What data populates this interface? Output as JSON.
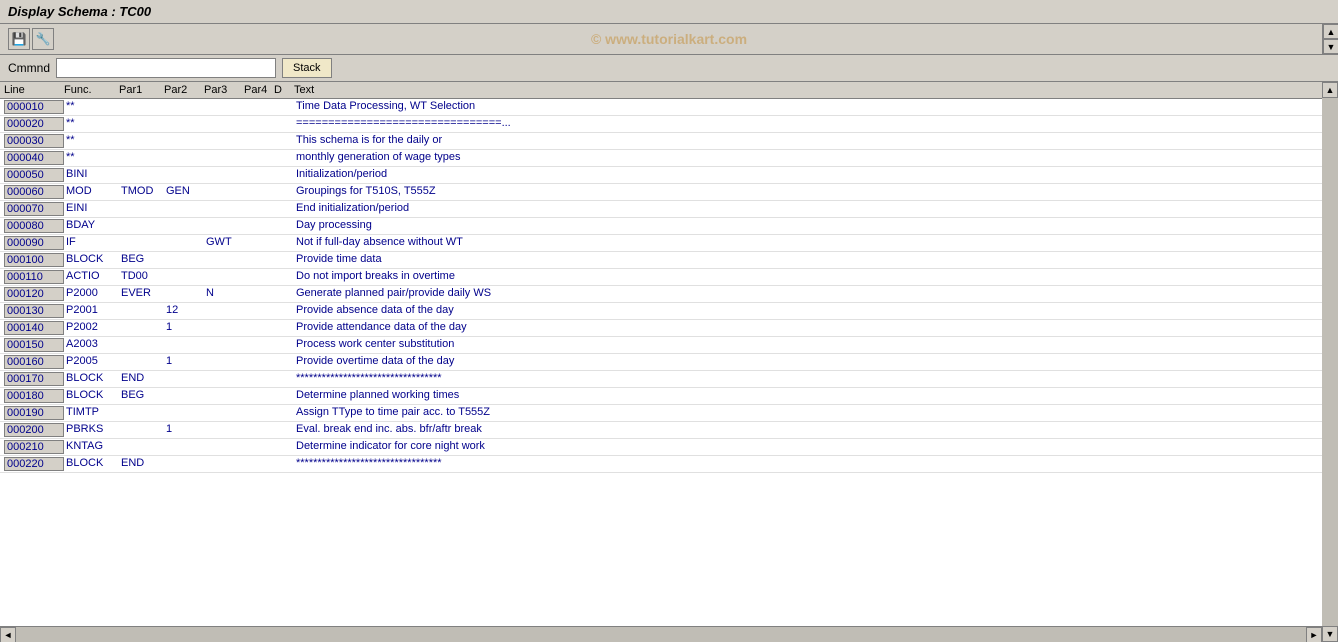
{
  "title": "Display Schema : TC00",
  "watermark": "© www.tutorialkart.com",
  "command": {
    "label": "Cmmnd",
    "placeholder": "",
    "stack_button": "Stack"
  },
  "table": {
    "headers": [
      "Line",
      "Func.",
      "Par1",
      "Par2",
      "Par3",
      "Par4",
      "D",
      "Text"
    ],
    "rows": [
      {
        "line": "000010",
        "func": "**",
        "par1": "",
        "par2": "",
        "par3": "",
        "par4": "",
        "d": "",
        "text": "Time Data Processing, WT Selection"
      },
      {
        "line": "000020",
        "func": "**",
        "par1": "",
        "par2": "",
        "par3": "",
        "par4": "",
        "d": "",
        "text": "================================..."
      },
      {
        "line": "000030",
        "func": "**",
        "par1": "",
        "par2": "",
        "par3": "",
        "par4": "",
        "d": "",
        "text": "This schema is for the daily or"
      },
      {
        "line": "000040",
        "func": "**",
        "par1": "",
        "par2": "",
        "par3": "",
        "par4": "",
        "d": "",
        "text": "monthly generation of wage types"
      },
      {
        "line": "000050",
        "func": "BINI",
        "par1": "",
        "par2": "",
        "par3": "",
        "par4": "",
        "d": "",
        "text": "Initialization/period"
      },
      {
        "line": "000060",
        "func": "MOD",
        "par1": "TMOD",
        "par2": "GEN",
        "par3": "",
        "par4": "",
        "d": "",
        "text": "Groupings for T510S, T555Z"
      },
      {
        "line": "000070",
        "func": "EINI",
        "par1": "",
        "par2": "",
        "par3": "",
        "par4": "",
        "d": "",
        "text": "End initialization/period"
      },
      {
        "line": "000080",
        "func": "BDAY",
        "par1": "",
        "par2": "",
        "par3": "",
        "par4": "",
        "d": "",
        "text": "Day processing"
      },
      {
        "line": "000090",
        "func": "IF",
        "par1": "",
        "par2": "",
        "par3": "GWT",
        "par4": "",
        "d": "",
        "text": "Not if full-day absence without WT"
      },
      {
        "line": "000100",
        "func": "BLOCK",
        "par1": "BEG",
        "par2": "",
        "par3": "",
        "par4": "",
        "d": "",
        "text": "Provide time data"
      },
      {
        "line": "000110",
        "func": "ACTIO",
        "par1": "TD00",
        "par2": "",
        "par3": "",
        "par4": "",
        "d": "",
        "text": "Do not import breaks in overtime"
      },
      {
        "line": "000120",
        "func": "P2000",
        "par1": "EVER",
        "par2": "",
        "par3": "N",
        "par4": "",
        "d": "",
        "text": "Generate planned pair/provide daily WS"
      },
      {
        "line": "000130",
        "func": "P2001",
        "par1": "",
        "par2": "12",
        "par3": "",
        "par4": "",
        "d": "",
        "text": "Provide absence data of the day"
      },
      {
        "line": "000140",
        "func": "P2002",
        "par1": "",
        "par2": "1",
        "par3": "",
        "par4": "",
        "d": "",
        "text": "Provide attendance data of the day"
      },
      {
        "line": "000150",
        "func": "A2003",
        "par1": "",
        "par2": "",
        "par3": "",
        "par4": "",
        "d": "",
        "text": "Process work center substitution"
      },
      {
        "line": "000160",
        "func": "P2005",
        "par1": "",
        "par2": "1",
        "par3": "",
        "par4": "",
        "d": "",
        "text": "Provide overtime data of the day"
      },
      {
        "line": "000170",
        "func": "BLOCK",
        "par1": "END",
        "par2": "",
        "par3": "",
        "par4": "",
        "d": "",
        "text": "**********************************"
      },
      {
        "line": "000180",
        "func": "BLOCK",
        "par1": "BEG",
        "par2": "",
        "par3": "",
        "par4": "",
        "d": "",
        "text": "Determine planned working times"
      },
      {
        "line": "000190",
        "func": "TIMTP",
        "par1": "",
        "par2": "",
        "par3": "",
        "par4": "",
        "d": "",
        "text": "Assign TType to time pair acc. to T555Z"
      },
      {
        "line": "000200",
        "func": "PBRKS",
        "par1": "",
        "par2": "1",
        "par3": "",
        "par4": "",
        "d": "",
        "text": "Eval. break end inc. abs. bfr/aftr break"
      },
      {
        "line": "000210",
        "func": "KNTAG",
        "par1": "",
        "par2": "",
        "par3": "",
        "par4": "",
        "d": "",
        "text": "Determine indicator for core night work"
      },
      {
        "line": "000220",
        "func": "BLOCK",
        "par1": "END",
        "par2": "",
        "par3": "",
        "par4": "",
        "d": "",
        "text": "**********************************"
      }
    ]
  },
  "toolbar_icons": [
    {
      "name": "save-icon",
      "symbol": "💾"
    },
    {
      "name": "properties-icon",
      "symbol": "🔧"
    }
  ]
}
